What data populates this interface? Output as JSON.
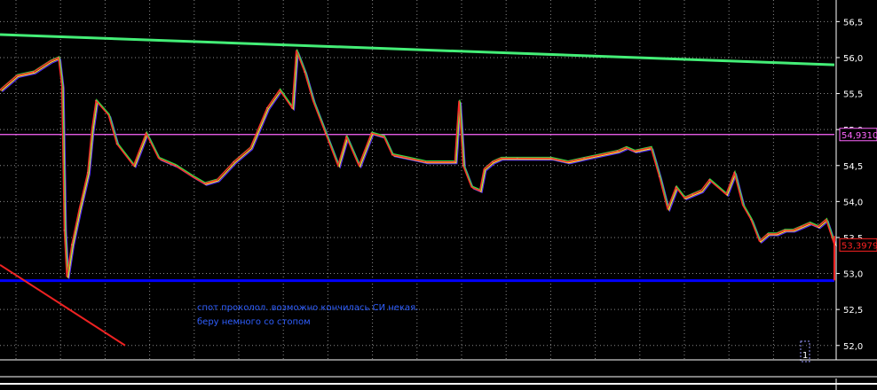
{
  "chart_data": {
    "type": "line",
    "instrument_kind": "price chart (candles with moving averages)",
    "y_axis": {
      "min": 51.8,
      "max": 56.8,
      "ticks": [
        "56,5",
        "56,0",
        "55,5",
        "55,0",
        "54,5",
        "54,0",
        "53,5",
        "53,0",
        "52,5",
        "52,0"
      ],
      "tick_values": [
        56.5,
        56.0,
        55.5,
        55.0,
        54.5,
        54.0,
        53.5,
        53.0,
        52.5,
        52.0
      ]
    },
    "x_axis": {
      "index_min": 0,
      "index_max": 100,
      "labels": []
    },
    "grid": true,
    "price_series": {
      "name": "",
      "x": [
        0,
        2,
        4,
        6,
        7,
        7.4,
        7.7,
        8,
        8.6,
        9.5,
        10.5,
        11,
        11.5,
        13,
        14,
        16,
        17.5,
        19,
        21,
        23,
        24.5,
        26,
        28,
        30,
        32,
        33.5,
        35,
        35.5,
        36.5,
        37.5,
        39,
        40.5,
        41.5,
        43,
        44.5,
        46,
        47,
        49,
        51,
        53,
        54.5,
        55,
        55.5,
        56.5,
        57.5,
        58,
        59,
        60,
        62,
        64,
        66,
        68,
        70,
        72,
        74,
        75,
        76,
        78,
        79,
        80,
        81,
        82,
        83,
        84,
        85,
        87,
        88,
        89,
        90,
        91,
        92,
        93,
        94,
        95,
        96,
        97,
        98,
        99,
        100
      ],
      "y": [
        55.55,
        55.75,
        55.8,
        55.95,
        56.0,
        55.6,
        53.6,
        52.95,
        53.4,
        53.9,
        54.4,
        55.0,
        55.4,
        55.2,
        54.8,
        54.5,
        54.95,
        54.6,
        54.5,
        54.35,
        54.25,
        54.3,
        54.55,
        54.75,
        55.3,
        55.55,
        55.3,
        56.1,
        55.8,
        55.4,
        54.95,
        54.5,
        54.9,
        54.5,
        54.95,
        54.9,
        54.65,
        54.6,
        54.55,
        54.55,
        54.55,
        55.4,
        54.5,
        54.2,
        54.15,
        54.45,
        54.55,
        54.6,
        54.6,
        54.6,
        54.6,
        54.55,
        54.6,
        54.65,
        54.7,
        54.75,
        54.7,
        54.75,
        54.35,
        53.9,
        54.2,
        54.05,
        54.1,
        54.15,
        54.3,
        54.1,
        54.4,
        53.95,
        53.75,
        53.45,
        53.55,
        53.55,
        53.6,
        53.6,
        53.65,
        53.7,
        53.65,
        53.75,
        53.4
      ]
    },
    "trendlines": [
      {
        "color": "#44ee77",
        "from": [
          0,
          56.32
        ],
        "to": [
          100,
          55.9
        ]
      },
      {
        "color": "#ee2222",
        "from": [
          0,
          53.12
        ],
        "to": [
          15,
          52.0
        ]
      }
    ],
    "horizontal_levels": [
      {
        "value": 54.931,
        "color": "#ff66ff",
        "label": "54,9310"
      },
      {
        "value": 52.9,
        "color": "#0000ff",
        "label": ""
      }
    ],
    "last_price": {
      "value": 53.397,
      "label": "53,3979",
      "color": "#ff2222"
    },
    "annotation": {
      "lines": [
        "спот проколол. возможно кончилась СИ некая.",
        "беру немного со стопом"
      ],
      "color": "#2f5fff"
    },
    "cursor_box_label": "1"
  }
}
